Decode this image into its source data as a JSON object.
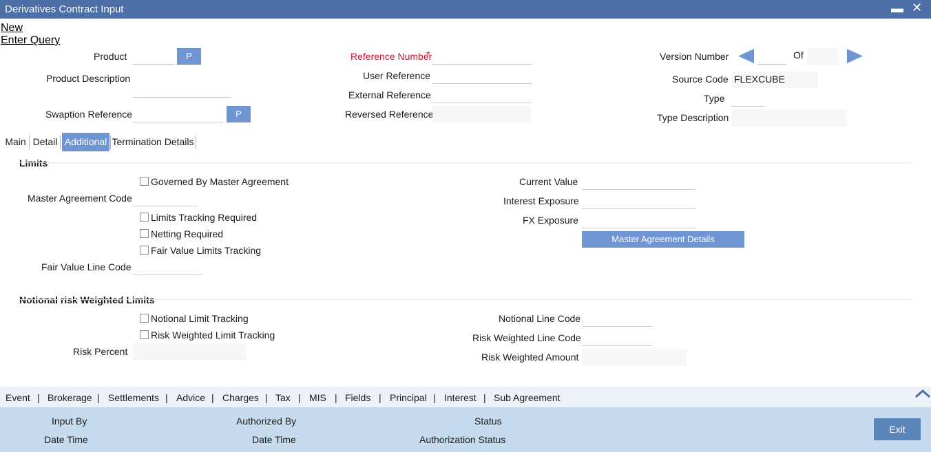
{
  "window": {
    "title": "Derivatives Contract Input",
    "minimize_glyph": "▬",
    "close_glyph": "✕"
  },
  "menu": {
    "new": "New",
    "enter_query": "Enter Query"
  },
  "header": {
    "product_label": "Product",
    "product_description_label": "Product Description",
    "swaption_reference_label": "Swaption Reference",
    "lov_button_label": "P",
    "reference_number_label": "Reference Number",
    "required_mark": "*",
    "user_reference_label": "User Reference",
    "external_reference_label": "External Reference",
    "reversed_reference_label": "Reversed Reference",
    "version_number_label": "Version Number",
    "of_label": "Of",
    "source_code_label": "Source Code",
    "source_code_value": "FLEXCUBE",
    "type_label": "Type",
    "type_description_label": "Type Description"
  },
  "tabs": [
    {
      "label": "Main"
    },
    {
      "label": "Detail"
    },
    {
      "label": "Additional",
      "active": true
    },
    {
      "label": "Termination Details"
    }
  ],
  "limits": {
    "section_title": "Limits",
    "governed_by_master_agreement": "Governed By Master Agreement",
    "master_agreement_code_label": "Master Agreement Code",
    "limits_tracking_required": "Limits Tracking Required",
    "netting_required": "Netting Required",
    "fair_value_limits_tracking": "Fair Value Limits Tracking",
    "fair_value_line_code_label": "Fair Value Line Code",
    "current_value_label": "Current Value",
    "interest_exposure_label": "Interest Exposure",
    "fx_exposure_label": "FX Exposure",
    "master_agreement_details_button": "Master Agreement Details"
  },
  "notional": {
    "section_title": "Notional risk Weighted Limits",
    "notional_limit_tracking": "Notional Limit Tracking",
    "risk_weighted_limit_tracking": "Risk Weighted Limit Tracking",
    "risk_percent_label": "Risk Percent",
    "notional_line_code_label": "Notional Line Code",
    "risk_weighted_line_code_label": "Risk Weighted Line Code",
    "risk_weighted_amount_label": "Risk Weighted Amount"
  },
  "bottom_nav": {
    "items": [
      "Event",
      "Brokerage",
      "Settlements",
      "Advice",
      "Charges",
      "Tax",
      "MIS",
      "Fields",
      "Principal",
      "Interest",
      "Sub Agreement"
    ],
    "separator": "|"
  },
  "footer": {
    "input_by_label": "Input By",
    "date_time_label": "Date Time",
    "authorized_by_label": "Authorized By",
    "date_time_label_2": "Date Time",
    "status_label": "Status",
    "authorization_status_label": "Authorization Status",
    "exit_button": "Exit"
  },
  "colors": {
    "title_bar": "#4b6fa6",
    "accent": "#6f96d2",
    "footer": "#c6dbee",
    "required": "#c0152f"
  },
  "icons": {
    "prev_version": "triangle-left-icon",
    "next_version": "triangle-right-icon",
    "collapse": "chevron-up-icon"
  }
}
